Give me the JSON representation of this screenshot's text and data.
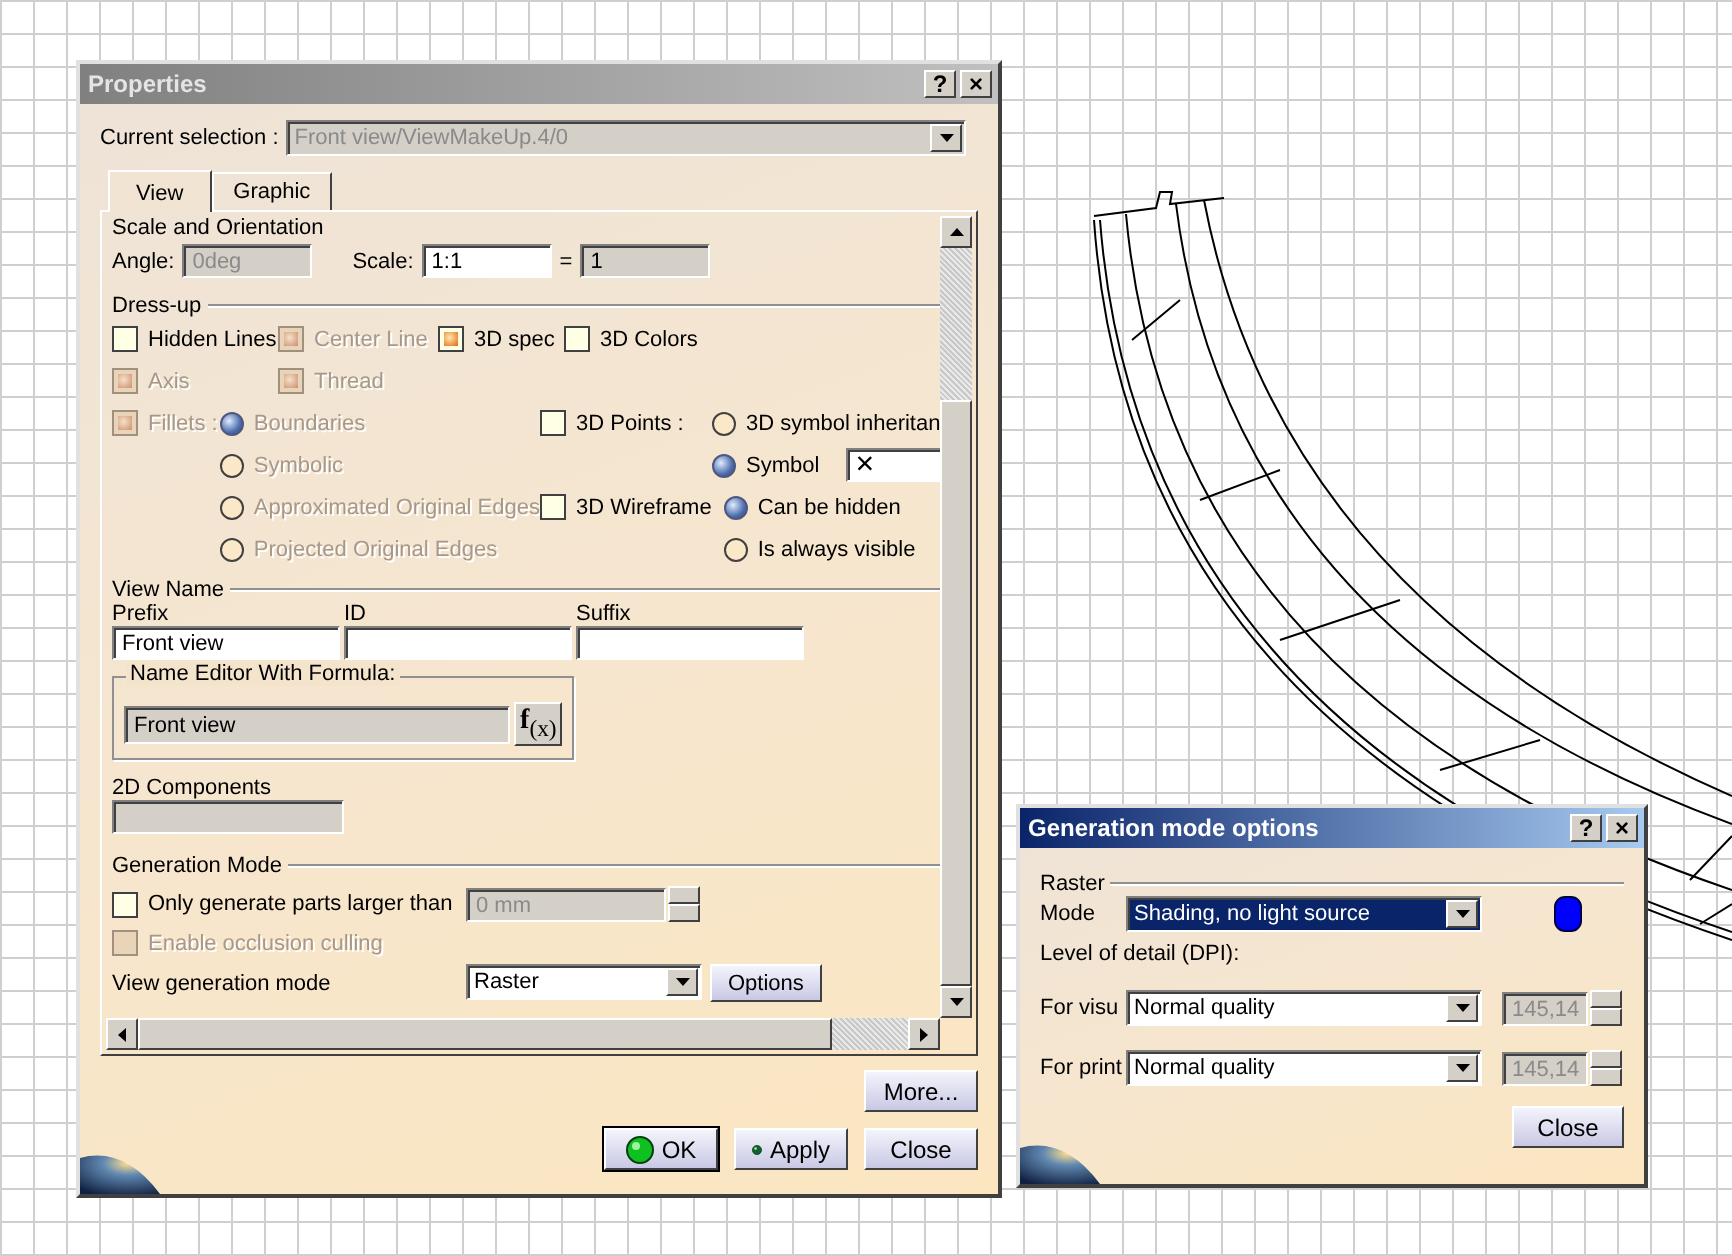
{
  "properties_window": {
    "title": "Properties",
    "active": false,
    "title_buttons": [
      "?",
      "×"
    ]
  },
  "current_selection": {
    "label": "Current selection :",
    "value": "Front view/ViewMakeUp.4/0"
  },
  "tabs": [
    {
      "label": "View",
      "selected": true
    },
    {
      "label": "Graphic",
      "selected": false
    }
  ],
  "scale_and_orientation": {
    "title": "Scale and Orientation",
    "angle_label": "Angle:",
    "angle": "0deg",
    "scale_label": "Scale:",
    "scale": "1:1",
    "equals": "=",
    "scale_result": "1"
  },
  "dress_up": {
    "title": "Dress-up",
    "checkbox_rows": [
      [
        {
          "label": "Hidden Lines",
          "checked": false,
          "disabled": false
        },
        {
          "label": "Center Line",
          "checked": true,
          "disabled": true
        },
        {
          "label": "3D spec",
          "checked": true,
          "disabled": false
        },
        {
          "label": "3D Colors",
          "checked": false,
          "disabled": false
        }
      ],
      [
        {
          "label": "Axis",
          "checked": true,
          "disabled": true
        },
        {
          "label": "Thread",
          "checked": true,
          "disabled": true
        }
      ]
    ],
    "fillets": {
      "label": "Fillets :",
      "checked": true,
      "disabled": true,
      "options": [
        {
          "label": "Boundaries",
          "selected": true,
          "disabled": true
        },
        {
          "label": "Symbolic",
          "selected": false,
          "disabled": true
        },
        {
          "label": "Approximated Original Edges",
          "selected": false,
          "disabled": true
        },
        {
          "label": "Projected Original Edges",
          "selected": false,
          "disabled": true
        }
      ]
    },
    "points_3d": {
      "label": "3D Points :",
      "checked": false,
      "disabled": false,
      "options": [
        {
          "label": "3D symbol inheritan",
          "selected": false,
          "disabled": false
        },
        {
          "label": "Symbol",
          "selected": true,
          "disabled": false,
          "symbol": "×"
        }
      ]
    },
    "wireframe_3d": {
      "label": "3D Wireframe",
      "checked": false,
      "disabled": false,
      "options": [
        {
          "label": "Can be hidden",
          "selected": true,
          "disabled": false
        },
        {
          "label": "Is always visible",
          "selected": false,
          "disabled": false
        }
      ]
    }
  },
  "view_name": {
    "title": "View Name",
    "fields": [
      {
        "label": "Prefix",
        "value": "Front view"
      },
      {
        "label": "ID"
      },
      {
        "label": "Suffix"
      }
    ],
    "formula": {
      "title": "Name Editor With Formula:",
      "value": "Front view",
      "button": "**f**$_{(x)}$"
    }
  },
  "components_2d": {
    "label": "2D Components"
  },
  "generation_mode": {
    "title": "Generation Mode",
    "size_limit": {
      "label": "Only generate parts larger than",
      "checked": false,
      "disabled": false,
      "value": "0 mm"
    },
    "occlusion": {
      "label": "Enable occlusion culling",
      "checked": false,
      "disabled": true
    },
    "view_mode": {
      "label": "View generation mode",
      "value": "Raster",
      "button": "Options"
    }
  },
  "more_button": "More...",
  "dialog_buttons": [
    {
      "label": "OK",
      "kind": "ok",
      "default": true
    },
    {
      "label": "Apply",
      "kind": "apply",
      "default": false
    },
    {
      "label": "Close",
      "kind": "plain",
      "default": false
    }
  ],
  "generation_options_window": {
    "title": "Generation mode options",
    "active": true,
    "title_buttons": [
      "?",
      "×"
    ],
    "section": "Raster",
    "mode": {
      "label": "Mode",
      "value": "Shading, no light source"
    },
    "detail_label": "Level of detail (DPI):",
    "rows": [
      {
        "label": "For visu",
        "value": "Normal quality",
        "dpi": "145,14"
      },
      {
        "label": "For print",
        "value": "Normal quality",
        "dpi": "145,14"
      }
    ],
    "close": "Close"
  }
}
